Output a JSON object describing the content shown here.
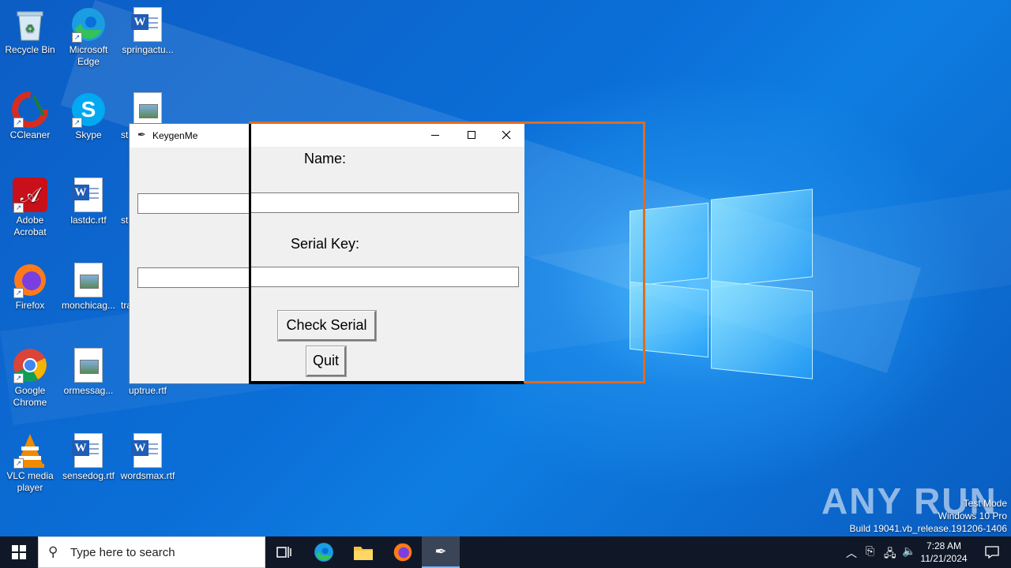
{
  "desktop": {
    "icons": [
      {
        "label": "Recycle Bin",
        "icon": "recycle-bin-icon"
      },
      {
        "label": "Microsoft Edge",
        "icon": "edge-icon"
      },
      {
        "label": "springactu...",
        "icon": "word-doc-icon"
      },
      {
        "label": "CCleaner",
        "icon": "ccleaner-icon"
      },
      {
        "label": "Skype",
        "icon": "skype-icon"
      },
      {
        "label": "st",
        "icon": "image-file-icon"
      },
      {
        "label": "Adobe Acrobat",
        "icon": "acrobat-icon"
      },
      {
        "label": "lastdc.rtf",
        "icon": "word-doc-icon"
      },
      {
        "label": "sta",
        "icon": "image-file-icon"
      },
      {
        "label": "Firefox",
        "icon": "firefox-icon"
      },
      {
        "label": "monchicag...",
        "icon": "image-file-icon"
      },
      {
        "label": "tra",
        "icon": "image-file-icon"
      },
      {
        "label": "Google Chrome",
        "icon": "chrome-icon"
      },
      {
        "label": "ormessag...",
        "icon": "image-file-icon"
      },
      {
        "label": "uptrue.rtf",
        "icon": "word-doc-icon"
      },
      {
        "label": "VLC media player",
        "icon": "vlc-icon"
      },
      {
        "label": "sensedog.rtf",
        "icon": "word-doc-icon"
      },
      {
        "label": "wordsmax.rtf",
        "icon": "word-doc-icon"
      }
    ]
  },
  "keygen_window": {
    "title": "KeygenMe",
    "name_label": "Name:",
    "name_value": "",
    "serial_label": "Serial Key:",
    "serial_value": "",
    "check_button": "Check Serial",
    "quit_button": "Quit",
    "minimize_glyph": "—",
    "maximize_glyph": "☐",
    "close_glyph": "✕"
  },
  "watermark": {
    "text": "ANY RUN",
    "line1": "Test Mode",
    "line2": "Windows 10 Pro",
    "line3": "Build 19041.vb_release.191206-1406"
  },
  "taskbar": {
    "search_placeholder": "Type here to search",
    "time": "7:28 AM",
    "date": "11/21/2024"
  },
  "colors": {
    "highlight_border": "#e06b1f",
    "taskbar": "#101828",
    "desktop_blue": "#0b6fd8"
  }
}
